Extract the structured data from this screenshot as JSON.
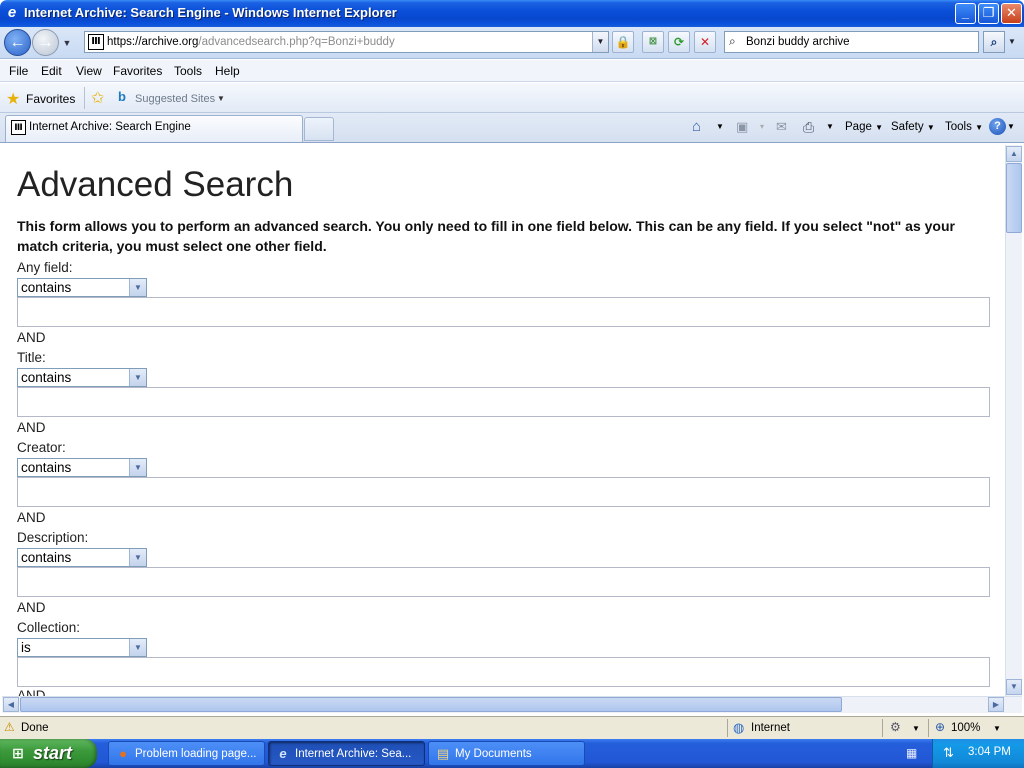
{
  "window": {
    "title": "Internet Archive: Search Engine - Windows Internet Explorer",
    "icon": "ie-logo-icon",
    "buttons": [
      "minimize",
      "maximize",
      "close"
    ]
  },
  "address_bar": {
    "url_host": "https://archive.org",
    "url_path": "/advancedsearch.php?q=Bonzi+buddy",
    "search_value": "Bonzi buddy archive"
  },
  "menu": [
    "File",
    "Edit",
    "View",
    "Favorites",
    "Tools",
    "Help"
  ],
  "favorites_bar": {
    "favorites_label": "Favorites",
    "suggested_label": "Suggested Sites"
  },
  "tab": {
    "label": "Internet Archive: Search Engine"
  },
  "command_bar": {
    "page": "Page",
    "safety": "Safety",
    "tools": "Tools"
  },
  "page": {
    "heading": "Advanced Search",
    "intro": "This form allows you to perform an advanced search. You only need to fill in one field below. This can be any field. If you select \"not\" as your match criteria, you must select one other field.",
    "and_label": "AND",
    "fields": [
      {
        "label": "Any field:",
        "match": "contains",
        "value": ""
      },
      {
        "label": "Title:",
        "match": "contains",
        "value": ""
      },
      {
        "label": "Creator:",
        "match": "contains",
        "value": ""
      },
      {
        "label": "Description:",
        "match": "contains",
        "value": ""
      },
      {
        "label": "Collection:",
        "match": "is",
        "value": ""
      }
    ]
  },
  "status_bar": {
    "status": "Done",
    "zone": "Internet",
    "zoom": "100%"
  },
  "taskbar": {
    "start_label": "start",
    "tasks": [
      {
        "label": "Problem loading page...",
        "active": false
      },
      {
        "label": "Internet Archive: Sea...",
        "active": true
      },
      {
        "label": "My Documents",
        "active": false
      }
    ],
    "clock": "3:04 PM"
  }
}
